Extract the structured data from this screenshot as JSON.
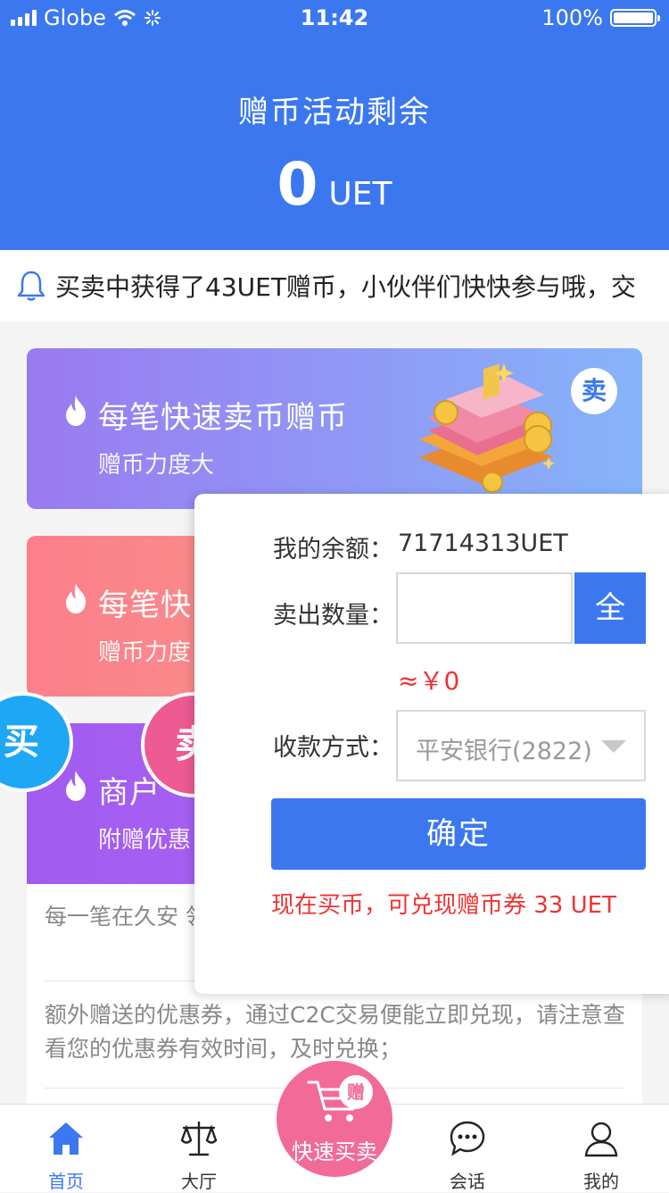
{
  "status_bar": {
    "carrier": "Globe",
    "time": "11:42",
    "battery": "100%"
  },
  "hero": {
    "title": "赠币活动剩余",
    "amount": "0",
    "unit": "UET"
  },
  "notice": {
    "text": "买卖中获得了43UET赠币，小伙伴们快快参与哦，交"
  },
  "cards": [
    {
      "title": "每笔快速卖币赠币",
      "subtitle": "赠币力度大",
      "badge": "卖"
    },
    {
      "title": "每笔快",
      "subtitle": "赠币力度"
    },
    {
      "title": "商户",
      "subtitle": "附赠优惠"
    }
  ],
  "info": {
    "para1": "每一笔在久安 领取红包，红",
    "para2": "额外赠送的优惠券，通过C2C交易便能立即兑现，请注意查看您的优惠券有效时间，及时兑换；"
  },
  "bubbles": {
    "buy": "买",
    "sell": "卖"
  },
  "sell_panel": {
    "balance_label": "我的余额：",
    "balance_value": "71714313UET",
    "qty_label": "卖出数量：",
    "qty_value": "",
    "all_button": "全",
    "approx": "≈￥0",
    "payment_label": "收款方式：",
    "payment_value": "平安银行(2822)",
    "confirm_button": "确定",
    "promo": "现在买币，可兑现赠币券 33 UET"
  },
  "tabbar": {
    "tabs": [
      {
        "label": "首页",
        "icon": "home-icon",
        "active": true
      },
      {
        "label": "大厅",
        "icon": "scale-icon"
      },
      {
        "label": "会话",
        "icon": "chat-icon"
      },
      {
        "label": "我的",
        "icon": "user-icon"
      }
    ],
    "quick": {
      "label": "快速买卖",
      "gift": "赠"
    }
  },
  "colors": {
    "primary": "#3b78f0",
    "danger": "#e33333",
    "pink": "#f26a98",
    "buy": "#1ea7f5"
  }
}
